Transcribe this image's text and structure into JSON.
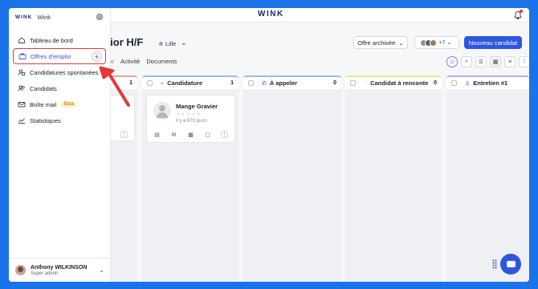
{
  "topbar": {
    "brand": "WINK"
  },
  "sidebar": {
    "logo": "WINK",
    "org": "Wink",
    "items": [
      {
        "label": "Tableau de bord",
        "icon": "home-icon"
      },
      {
        "label": "Offres d'emploi",
        "icon": "briefcase-icon",
        "active": true
      },
      {
        "label": "Candidatures spontanées",
        "icon": "user-inbox-icon"
      },
      {
        "label": "Candidats",
        "icon": "users-icon"
      },
      {
        "label": "Boîte mail",
        "icon": "mail-icon",
        "badge": "Beta"
      },
      {
        "label": "Statistiques",
        "icon": "chart-icon"
      }
    ],
    "user": {
      "name": "Anthony WILKINSON",
      "role": "Super admin"
    }
  },
  "job": {
    "title_visible": "enior H/F",
    "location": "Lille"
  },
  "header_buttons": {
    "archived": "Offre archivée",
    "team_count": "+7",
    "new_candidate": "Nouveau candidat"
  },
  "tabs": [
    "e",
    "Activité",
    "Documents"
  ],
  "columns": [
    {
      "name": "",
      "count": "1",
      "color": "#e8a0a0"
    },
    {
      "name": "Candidature",
      "count": "1",
      "color": "#9fb6f5"
    },
    {
      "name": "À appeler",
      "count": "0",
      "color": "#9fb6f5"
    },
    {
      "name": "Candidat à renconte",
      "count": "0",
      "color": "#d9ef8b"
    },
    {
      "name": "Entretien #1",
      "count": "",
      "color": "#c5a4f0"
    }
  ],
  "card": {
    "name": "Mange Gravier",
    "time": "il y a 973 jours",
    "stars": "★★★★★"
  }
}
